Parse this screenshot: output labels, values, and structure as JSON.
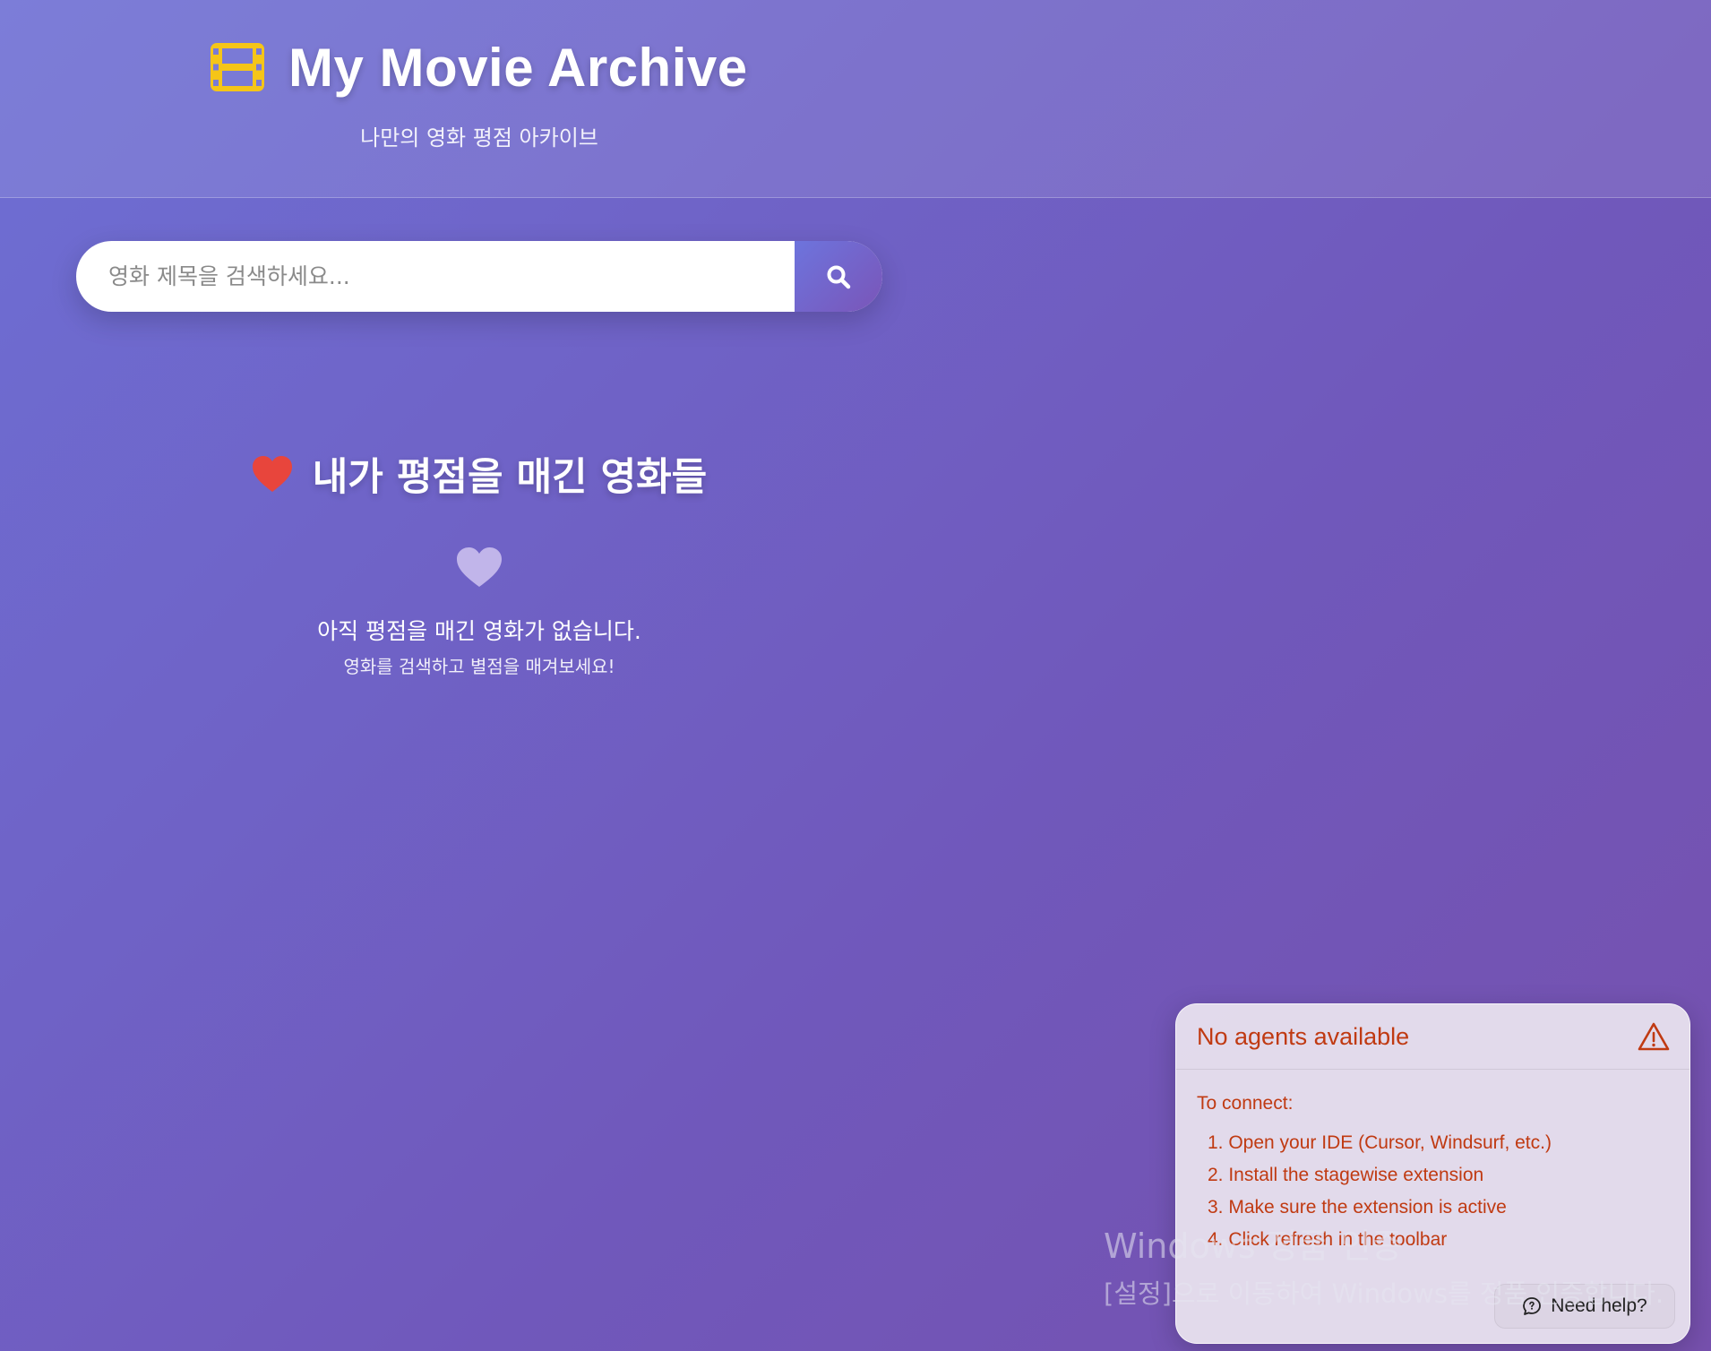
{
  "header": {
    "title": "My Movie Archive",
    "subtitle": "나만의 영화 평점 아카이브",
    "logo_icon": "film-icon",
    "logo_color": "#f5c518"
  },
  "search": {
    "placeholder": "영화 제목을 검색하세요...",
    "value": "",
    "button_icon": "search-icon"
  },
  "rated_section": {
    "title": "내가 평점을 매긴 영화들",
    "title_icon": "heart-icon",
    "heart_color": "#e8453c",
    "empty_icon": "heart-icon",
    "empty_message": "아직 평점을 매긴 영화가 없습니다.",
    "empty_hint": "영화를 검색하고 별점을 매겨보세요!"
  },
  "agent_panel": {
    "title": "No agents available",
    "warning_icon": "warning-icon",
    "connect_label": "To connect:",
    "steps": [
      "1. Open your IDE (Cursor, Windsurf, etc.)",
      "2. Install the stagewise extension",
      "3. Make sure the extension is active",
      "4. Click refresh in the toolbar"
    ],
    "help_button": "Need help?",
    "accent_color": "#c03a12"
  },
  "windows_watermark": {
    "line1": "Windows 정품 인증",
    "line2": "[설정]으로 이동하여 Windows를 정품 인증합니다."
  }
}
